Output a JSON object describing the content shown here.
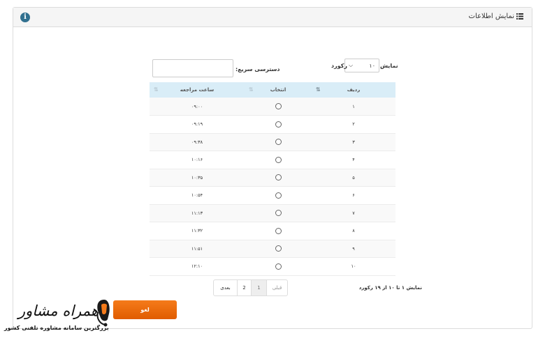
{
  "panel": {
    "title": "نمایش اطلاعات",
    "icon": "list-icon",
    "info_icon": "info-icon"
  },
  "length_menu": {
    "prefix": "نمایش",
    "value": "۱۰",
    "suffix": "رکورد"
  },
  "search": {
    "label": "دسترسی سریع:",
    "placeholder": ""
  },
  "table": {
    "headers": [
      "ردیف",
      "انتخاب",
      "ساعت مراجعه"
    ],
    "rows": [
      [
        "۱",
        "۰۹:۰۰"
      ],
      [
        "۲",
        "۰۹:۱۹"
      ],
      [
        "۳",
        "۰۹:۳۸"
      ],
      [
        "۴",
        "۱۰:۱۶"
      ],
      [
        "۵",
        "۱۰:۳۵"
      ],
      [
        "۶",
        "۱۰:۵۴"
      ],
      [
        "۷",
        "۱۱:۱۳"
      ],
      [
        "۸",
        "۱۱:۳۲"
      ],
      [
        "۹",
        "۱۱:۵۱"
      ],
      [
        "۱۰",
        "۱۲:۱۰"
      ]
    ]
  },
  "info_text": "نمایش ۱ تا ۱۰ از ۱۹ رکورد",
  "pagination": {
    "prev": "قبلی",
    "pages": [
      "1",
      "2"
    ],
    "current": "1",
    "next": "بعدی"
  },
  "cancel_button": "لغو",
  "watermark": {
    "brand": "همراه مشاور",
    "tagline": "بزرگترین سامانه مشاوره تلفنی کشور"
  },
  "colors": {
    "header_bg": "#d9edf7",
    "cancel": "#f26f0e",
    "info": "#31708f"
  }
}
